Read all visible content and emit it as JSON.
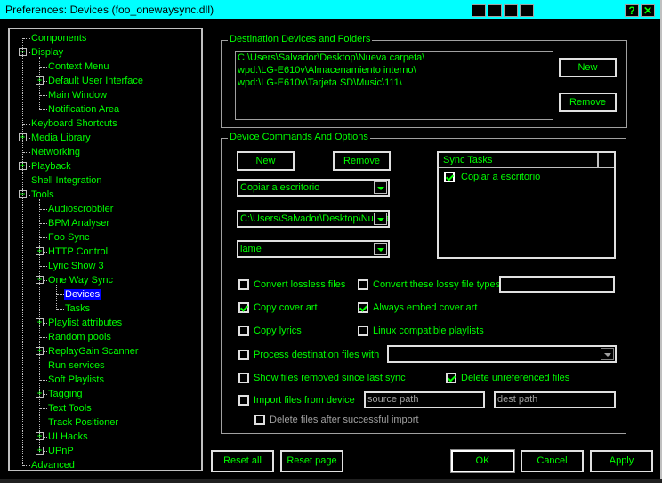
{
  "window": {
    "title": "Preferences: Devices (foo_onewaysync.dll)",
    "help_label": "?",
    "close_label": "✕"
  },
  "tree": {
    "items": [
      {
        "label": "Components",
        "level": 0,
        "expander": "none"
      },
      {
        "label": "Display",
        "level": 0,
        "expander": "minus"
      },
      {
        "label": "Context Menu",
        "level": 1,
        "expander": "none"
      },
      {
        "label": "Default User Interface",
        "level": 1,
        "expander": "plus"
      },
      {
        "label": "Main Window",
        "level": 1,
        "expander": "none"
      },
      {
        "label": "Notification Area",
        "level": 1,
        "expander": "none"
      },
      {
        "label": "Keyboard Shortcuts",
        "level": 0,
        "expander": "none"
      },
      {
        "label": "Media Library",
        "level": 0,
        "expander": "plus"
      },
      {
        "label": "Networking",
        "level": 0,
        "expander": "none"
      },
      {
        "label": "Playback",
        "level": 0,
        "expander": "plus"
      },
      {
        "label": "Shell Integration",
        "level": 0,
        "expander": "none"
      },
      {
        "label": "Tools",
        "level": 0,
        "expander": "minus"
      },
      {
        "label": "Audioscrobbler",
        "level": 1,
        "expander": "none"
      },
      {
        "label": "BPM Analyser",
        "level": 1,
        "expander": "none"
      },
      {
        "label": "Foo Sync",
        "level": 1,
        "expander": "none"
      },
      {
        "label": "HTTP Control",
        "level": 1,
        "expander": "plus"
      },
      {
        "label": "Lyric Show 3",
        "level": 1,
        "expander": "none"
      },
      {
        "label": "One Way Sync",
        "level": 1,
        "expander": "minus"
      },
      {
        "label": "Devices",
        "level": 2,
        "expander": "none",
        "selected": true
      },
      {
        "label": "Tasks",
        "level": 2,
        "expander": "none"
      },
      {
        "label": "Playlist attributes",
        "level": 1,
        "expander": "plus"
      },
      {
        "label": "Random pools",
        "level": 1,
        "expander": "none"
      },
      {
        "label": "ReplayGain Scanner",
        "level": 1,
        "expander": "plus"
      },
      {
        "label": "Run services",
        "level": 1,
        "expander": "none"
      },
      {
        "label": "Soft Playlists",
        "level": 1,
        "expander": "none"
      },
      {
        "label": "Tagging",
        "level": 1,
        "expander": "plus"
      },
      {
        "label": "Text Tools",
        "level": 1,
        "expander": "none"
      },
      {
        "label": "Track Positioner",
        "level": 1,
        "expander": "none"
      },
      {
        "label": "UI Hacks",
        "level": 1,
        "expander": "plus"
      },
      {
        "label": "UPnP",
        "level": 1,
        "expander": "plus"
      },
      {
        "label": "Advanced",
        "level": 0,
        "expander": "none"
      }
    ]
  },
  "destinations": {
    "group_label": "Destination Devices and Folders",
    "paths": [
      "C:\\Users\\Salvador\\Desktop\\Nueva carpeta\\",
      "wpd:\\LG-E610v\\Almacenamiento interno\\",
      "wpd:\\LG-E610v\\Tarjeta SD\\Music\\111\\"
    ],
    "new_label": "New",
    "remove_label": "Remove"
  },
  "commands": {
    "group_label": "Device Commands And Options",
    "new_label": "New",
    "remove_label": "Remove",
    "command_select": "Copiar a escritorio",
    "destination_select": "C:\\Users\\Salvador\\Desktop\\Nueva carpeta\\",
    "encoder_select": "lame",
    "sync_tasks": {
      "header": "Sync Tasks",
      "items": [
        {
          "label": "Copiar a escritorio",
          "checked": true
        }
      ]
    },
    "options": {
      "convert_lossless": {
        "label": "Convert lossless files",
        "checked": false
      },
      "convert_lossy": {
        "label": "Convert these lossy file types",
        "checked": false,
        "value": ""
      },
      "copy_cover_art": {
        "label": "Copy cover art",
        "checked": true
      },
      "always_embed": {
        "label": "Always embed cover art",
        "checked": true
      },
      "copy_lyrics": {
        "label": "Copy lyrics",
        "checked": false
      },
      "linux_playlists": {
        "label": "Linux compatible playlists",
        "checked": false
      },
      "process_destination": {
        "label": "Process destination files with",
        "checked": false,
        "value": ""
      },
      "show_removed": {
        "label": "Show files removed since last sync",
        "checked": false
      },
      "delete_unreferenced": {
        "label": "Delete unreferenced files",
        "checked": true
      },
      "import_files": {
        "label": "Import files from device",
        "checked": false
      },
      "source_path": "source path",
      "dest_path": "dest path",
      "delete_after_import": {
        "label": "Delete files after successful import",
        "checked": false
      }
    }
  },
  "footer": {
    "reset_all": "Reset all",
    "reset_page": "Reset page",
    "ok": "OK",
    "cancel": "Cancel",
    "apply": "Apply"
  },
  "colors": {
    "text": "#00ff00",
    "titlebar": "#00ffff",
    "selection": "#0000ff",
    "background": "#000000"
  }
}
